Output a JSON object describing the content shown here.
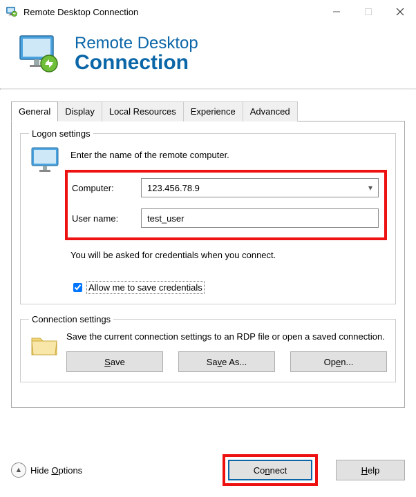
{
  "window": {
    "title": "Remote Desktop Connection"
  },
  "header": {
    "line1": "Remote Desktop",
    "line2": "Connection"
  },
  "tabs": {
    "general": "General",
    "display": "Display",
    "local_resources": "Local Resources",
    "experience": "Experience",
    "advanced": "Advanced"
  },
  "logon": {
    "legend": "Logon settings",
    "instruction": "Enter the name of the remote computer.",
    "computer_label": "Computer:",
    "computer_value": "123.456.78.9",
    "username_label": "User name:",
    "username_value": "test_user",
    "credentials_note": "You will be asked for credentials when you connect.",
    "save_creds_label": "Allow me to save credentials",
    "save_creds_checked": true
  },
  "connection": {
    "legend": "Connection settings",
    "instruction": "Save the current connection settings to an RDP file or open a saved connection.",
    "save_label": "Save",
    "save_as_label": "Save As...",
    "open_label": "Open..."
  },
  "footer": {
    "hide_options_label": "Hide Options",
    "connect_label": "Connect",
    "help_label": "Help"
  }
}
